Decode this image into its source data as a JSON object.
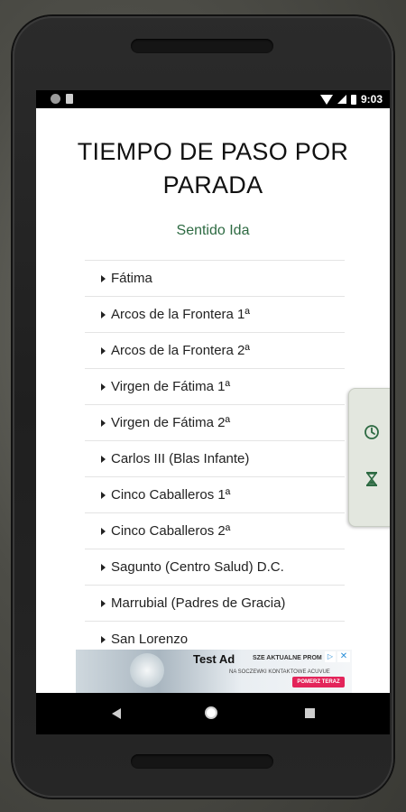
{
  "title": "TIEMPO DE PASO POR PARADA",
  "subtitle": "Sentido Ida",
  "status_time": "9:03",
  "stops": [
    "Fátima",
    "Arcos de la Frontera 1ª",
    "Arcos de la Frontera 2ª",
    "Virgen de Fátima 1ª",
    "Virgen de Fátima 2ª",
    "Carlos III (Blas Infante)",
    "Cinco Caballeros 1ª",
    "Cinco Caballeros 2ª",
    "Sagunto (Centro Salud) D.C.",
    "Marrubial (Padres de Gracia)",
    "San Lorenzo"
  ],
  "ad": {
    "label": "Test Ad",
    "headline": "SZE AKTUALNE PROM",
    "sub": "NA SOCZEWKI KONTAKTOWE ACUVUE",
    "cta": "POMERZ TERAZ"
  },
  "colors": {
    "subtitle": "#2d6a42",
    "floating_icons": "#2d6a42"
  },
  "icons": {
    "clock": "clock-icon",
    "hourglass": "hourglass-icon"
  }
}
